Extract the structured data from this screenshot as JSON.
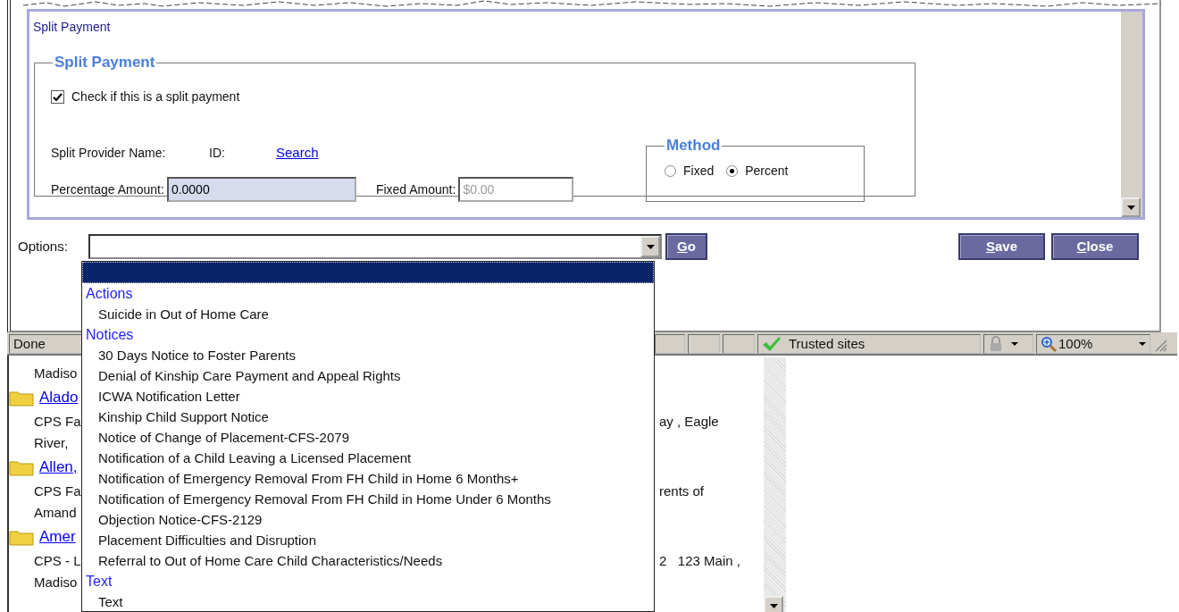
{
  "panel_caption": "Split Payment",
  "split_payment": {
    "legend": "Split Payment",
    "checkbox": {
      "label": "Check if this is a split payment",
      "checked": true
    },
    "provider_label": "Split Provider Name:",
    "id_label": "ID:",
    "search_link": "Search",
    "percentage": {
      "label": "Percentage Amount:",
      "value": "0.0000"
    },
    "fixed": {
      "label": "Fixed Amount:",
      "value": "$0.00",
      "disabled": true
    },
    "method": {
      "legend": "Method",
      "options": [
        {
          "label": "Fixed",
          "selected": false
        },
        {
          "label": "Percent",
          "selected": true
        }
      ]
    }
  },
  "options": {
    "label": "Options:",
    "buttons": [
      "Go",
      "Save",
      "Close"
    ]
  },
  "dropdown": {
    "groups": [
      {
        "label": "Actions",
        "items": [
          "Suicide in Out of Home Care"
        ]
      },
      {
        "label": "Notices",
        "items": [
          "30 Days Notice to Foster Parents",
          "Denial of Kinship Care Payment and Appeal Rights",
          "ICWA Notification Letter",
          "Kinship Child Support Notice",
          "Notice of Change of Placement-CFS-2079",
          "Notification of a Child Leaving a Licensed Placement",
          "Notification of Emergency Removal From FH Child in Home 6 Months+",
          "Notification of Emergency Removal From FH Child in Home Under 6 Months",
          "Objection Notice-CFS-2129",
          "Placement Difficulties and Disruption",
          "Referral to Out of Home Care Child Characteristics/Needs"
        ]
      },
      {
        "label": "Text",
        "items": [
          "Text"
        ]
      }
    ]
  },
  "status_bar": {
    "text": "Done",
    "zone": "Trusted sites",
    "zoom": "100%"
  },
  "lower_list": [
    {
      "kind": "text",
      "left": "Madiso"
    },
    {
      "kind": "folder",
      "link": "Alado"
    },
    {
      "kind": "text",
      "left": "CPS Fa",
      "right": "ay , Eagle"
    },
    {
      "kind": "text",
      "left": "River,"
    },
    {
      "kind": "folder",
      "link": "Allen,"
    },
    {
      "kind": "text",
      "left": "CPS Fa",
      "right": "rents of"
    },
    {
      "kind": "text",
      "left": "Amand"
    },
    {
      "kind": "folder",
      "link": "Amer"
    },
    {
      "kind": "text",
      "left": "CPS - L",
      "right": "2   123 Main ,"
    },
    {
      "kind": "text",
      "left": "Madiso"
    }
  ]
}
